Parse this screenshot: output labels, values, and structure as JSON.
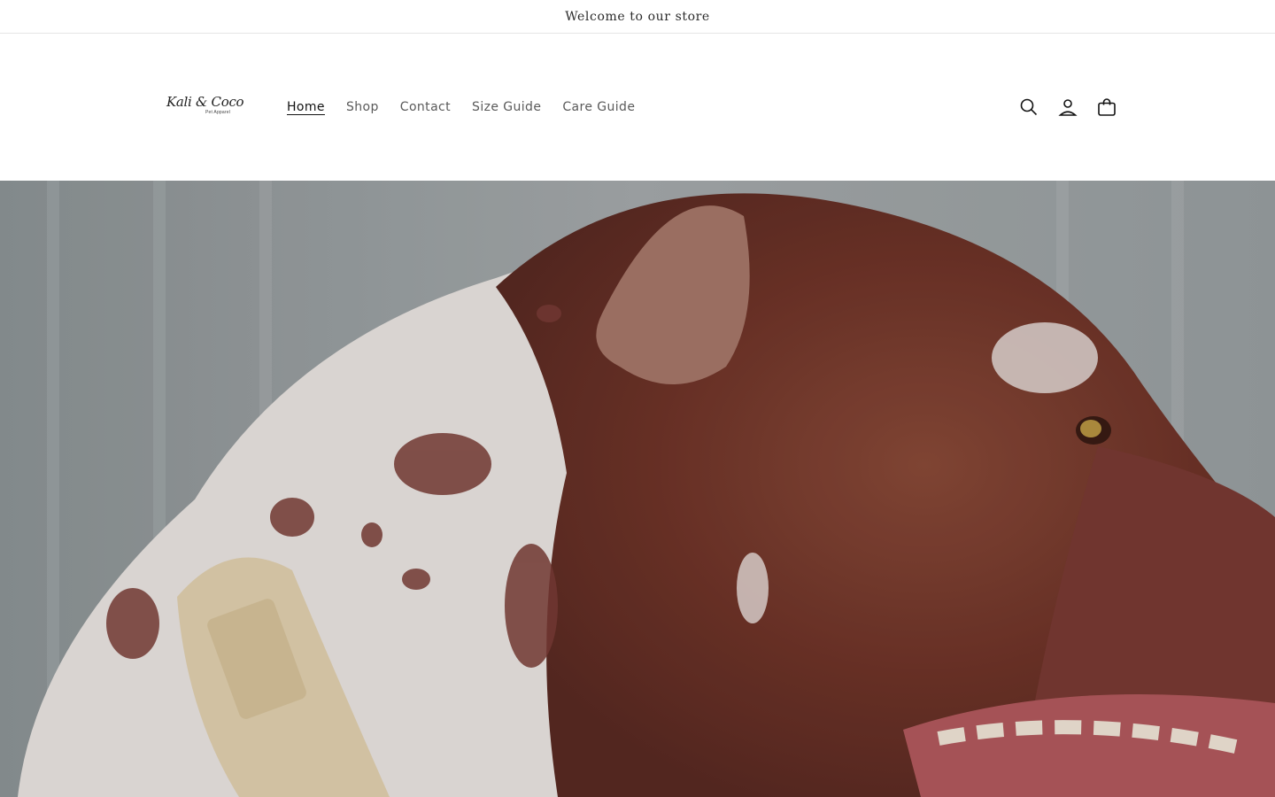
{
  "announcement": {
    "text": "Welcome to our store"
  },
  "header": {
    "logo": {
      "name": "Kali & Coco",
      "tagline": "Pet Apparel"
    },
    "nav": [
      {
        "label": "Home",
        "active": true
      },
      {
        "label": "Shop",
        "active": false
      },
      {
        "label": "Contact",
        "active": false
      },
      {
        "label": "Size Guide",
        "active": false
      },
      {
        "label": "Care Guide",
        "active": false
      }
    ],
    "icons": [
      "search-icon",
      "account-icon",
      "cart-icon"
    ]
  },
  "hero": {
    "image": "dog-profile-photo",
    "overlay": "dark-tint"
  },
  "colors": {
    "text": "#121212",
    "muted_nav": "#5a5a5a",
    "divider": "#e6e6e6"
  }
}
